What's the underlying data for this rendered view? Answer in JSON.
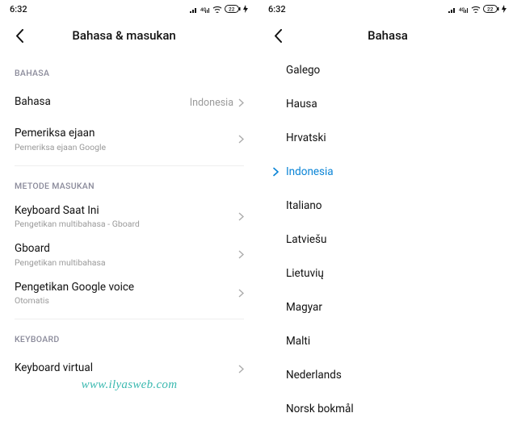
{
  "status": {
    "time": "6:32",
    "battery": "22"
  },
  "left": {
    "title": "Bahasa & masukan",
    "sections": {
      "bahasa": {
        "label": "BAHASA",
        "items": [
          {
            "title": "Bahasa",
            "value": "Indonesia"
          },
          {
            "title": "Pemeriksa ejaan",
            "sub": "Pemeriksa ejaan Google"
          }
        ]
      },
      "metode": {
        "label": "METODE MASUKAN",
        "items": [
          {
            "title": "Keyboard Saat Ini",
            "sub": "Pengetikan multibahasa - Gboard"
          },
          {
            "title": "Gboard",
            "sub": "Pengetikan multibahasa"
          },
          {
            "title": "Pengetikan Google voice",
            "sub": "Otomatis"
          }
        ]
      },
      "keyboard": {
        "label": "KEYBOARD",
        "items": [
          {
            "title": "Keyboard virtual"
          }
        ]
      }
    }
  },
  "right": {
    "title": "Bahasa",
    "languages": [
      "Galego",
      "Hausa",
      "Hrvatski",
      "Indonesia",
      "Italiano",
      "Latviešu",
      "Lietuvių",
      "Magyar",
      "Malti",
      "Nederlands",
      "Norsk bokmål"
    ],
    "selected": "Indonesia"
  },
  "watermark": "www.ilyasweb.com"
}
